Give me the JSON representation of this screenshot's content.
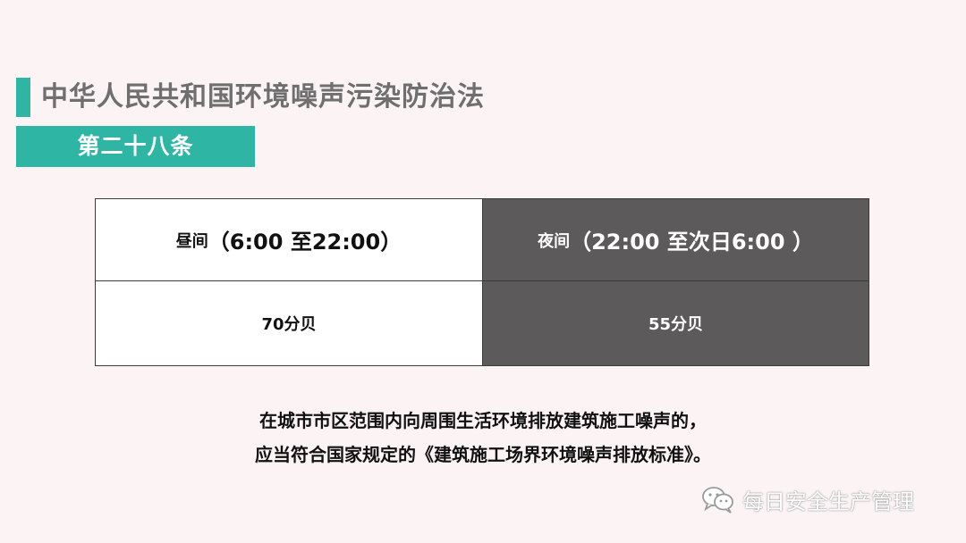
{
  "header": {
    "title": "中华人民共和国环境噪声污染防治法",
    "article": "第二十八条"
  },
  "table": {
    "day_label": "昼间",
    "day_range": "（6:00 至22:00）",
    "night_label": "夜间",
    "night_range": "（22:00 至次日6:00 ）",
    "day_limit": "70分贝",
    "night_limit": "55分贝"
  },
  "note": {
    "line1": "在城市市区范围内向周围生活环境排放建筑施工噪声的，",
    "line2": "应当符合国家规定的《建筑施工场界环境噪声排放标准》。"
  },
  "watermark": {
    "icon": "wechat-icon",
    "text": "每日安全生产管理"
  },
  "colors": {
    "accent": "#2fb5a3",
    "dark_cell": "#5c5a5b",
    "background": "#fbf3f4",
    "title_text": "#6f6f6f"
  }
}
